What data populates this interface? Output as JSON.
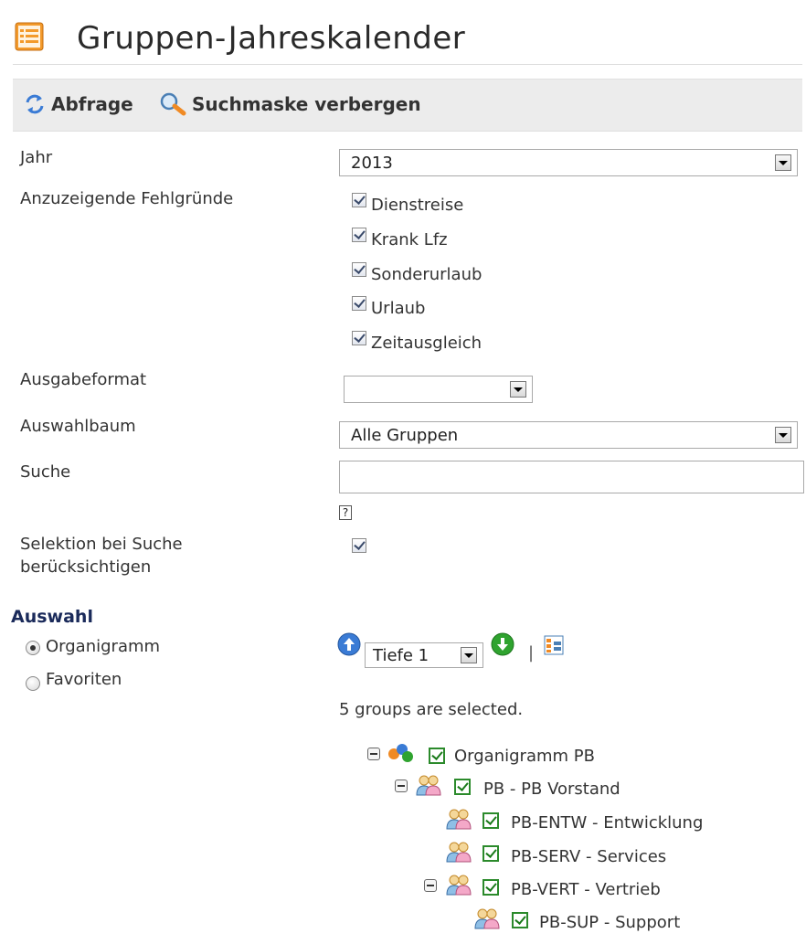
{
  "page": {
    "title": "Gruppen-Jahreskalender"
  },
  "toolbar": {
    "query_label": "Abfrage",
    "hide_search_label": "Suchmaske verbergen"
  },
  "form": {
    "year": {
      "label": "Jahr",
      "value": "2013"
    },
    "reasons": {
      "label": "Anzuzeigende Fehlgründe",
      "items": [
        {
          "label": "Dienstreise",
          "checked": true
        },
        {
          "label": "Krank Lfz",
          "checked": true
        },
        {
          "label": "Sonderurlaub",
          "checked": true
        },
        {
          "label": "Urlaub",
          "checked": true
        },
        {
          "label": "Zeitausgleich",
          "checked": true
        }
      ]
    },
    "output_format": {
      "label": "Ausgabeformat",
      "value": ""
    },
    "tree_select": {
      "label": "Auswahlbaum",
      "value": "Alle Gruppen"
    },
    "search": {
      "label": "Suche",
      "value": "",
      "help": "?"
    },
    "selection_in_search": {
      "label_line1": "Selektion bei Suche",
      "label_line2": "berücksichtigen",
      "checked": true
    }
  },
  "selection": {
    "heading": "Auswahl",
    "options": [
      {
        "label": "Organigramm",
        "selected": true
      },
      {
        "label": "Favoriten",
        "selected": false
      }
    ],
    "depth": "Tiefe 1",
    "separator": "|",
    "status": "5 groups are selected."
  },
  "tree": {
    "nodes": [
      {
        "label": "Organigramm PB",
        "level": 0,
        "expandable": true,
        "checked": true
      },
      {
        "label": "PB - PB Vorstand",
        "level": 1,
        "expandable": true,
        "checked": true
      },
      {
        "label": "PB-ENTW - Entwicklung",
        "level": 2,
        "expandable": false,
        "checked": true
      },
      {
        "label": "PB-SERV - Services",
        "level": 2,
        "expandable": false,
        "checked": true
      },
      {
        "label": "PB-VERT - Vertrieb",
        "level": 2,
        "expandable": true,
        "checked": true
      },
      {
        "label": "PB-SUP - Support",
        "level": 3,
        "expandable": false,
        "checked": true
      }
    ]
  },
  "icons": {
    "title": "calendar-list-icon",
    "query": "refresh-arrows-icon",
    "hide_search": "magnifier-icon",
    "depth_up": "arrow-up-circle-icon",
    "depth_down": "arrow-down-circle-icon",
    "tree_view": "orgchart-icon",
    "root": "organigram-icon",
    "group": "group-users-icon"
  },
  "colors": {
    "toolbar_bg": "#ececec",
    "check_green": "#2b8a2b",
    "accent_blue": "#3a7bd5",
    "accent_orange": "#f08a24"
  }
}
